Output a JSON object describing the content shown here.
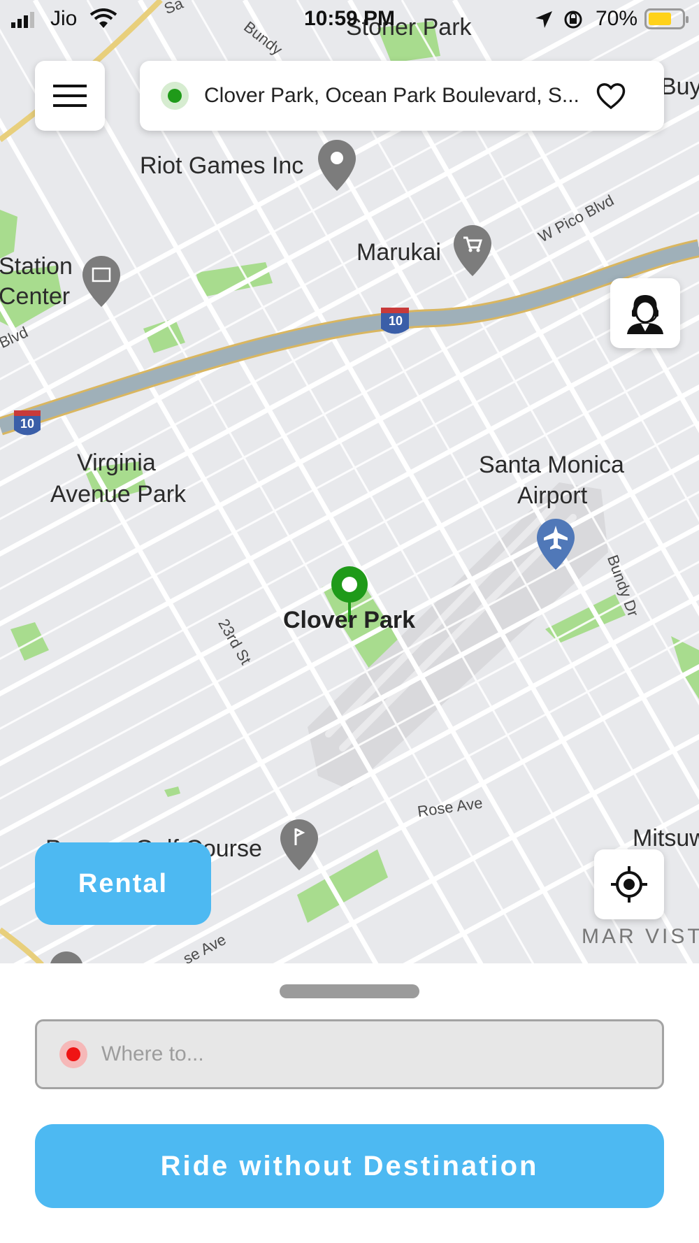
{
  "status_bar": {
    "carrier": "Jio",
    "time": "10:59 PM",
    "battery_percent": "70%",
    "icons": [
      "signal-icon",
      "wifi-icon",
      "location-arrow-icon",
      "orientation-lock-icon",
      "battery-icon"
    ],
    "battery_level": 0.7,
    "battery_color": "#ffd21a"
  },
  "header": {
    "menu_icon": "hamburger-icon",
    "pickup_location": "Clover Park, Ocean Park Boulevard, S...",
    "pickup_dot_color": "#1f9a19",
    "favorite_icon": "heart-icon"
  },
  "map": {
    "labels": {
      "stoner_park": "Stoner Park",
      "riot_games": "Riot Games Inc",
      "marukai": "Marukai",
      "station_center_1": "Station",
      "station_center_2": "Center",
      "w_pico_blvd": "W Pico Blvd",
      "virginia_park_1": "Virginia",
      "virginia_park_2": "Avenue Park",
      "santa_monica_airport_1": "Santa Monica",
      "santa_monica_airport_2": "Airport",
      "clover_park": "Clover Park",
      "st_23rd": "23rd St",
      "bundy_dr": "Bundy Dr",
      "bundy_top": "Bundy",
      "rose_ave": "Rose Ave",
      "golf_course": "Penmar Golf Course",
      "mitsuwa": "Mitsuw",
      "mar_vista": "MAR VIST",
      "buy": "Buy",
      "blvd": "Blvd",
      "se_ave": "se Ave",
      "sa": "Sa",
      "interstate_1": "10",
      "interstate_2": "10"
    },
    "pin_icon": "location-pin-icon",
    "colors": {
      "park": "#a8dc8e",
      "road": "#ffffff",
      "freeway": "#9fb0b9",
      "airport": "#d9d9dc",
      "selected_pin": "#1f9a19"
    }
  },
  "support_icon": "customer-support-icon",
  "rental_button": {
    "label": "Rental",
    "color": "#4db9f2"
  },
  "locate_icon": "crosshair-icon",
  "bottom_sheet": {
    "destination_placeholder": "Where to...",
    "destination_dot_color": "#ef1414",
    "ride_button_label": "Ride without Destination"
  }
}
